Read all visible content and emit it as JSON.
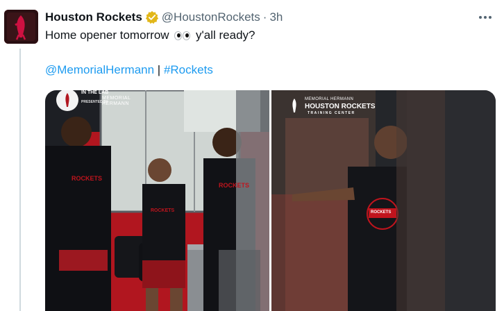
{
  "tweet": {
    "author_name": "Houston Rockets",
    "handle": "@HoustonRockets",
    "separator": "·",
    "time": "3h",
    "text_before": "Home opener tomorrow",
    "text_after": "y'all ready?",
    "emoji": "eyes",
    "mention": "@MemorialHermann",
    "tag_separator": " | ",
    "hashtag": "#Rockets"
  },
  "media": {
    "photo1": {
      "badge_title": "IN THE LAB",
      "badge_presented": "PRESENTED BY",
      "sponsor_line1": "MEMORIAL",
      "sponsor_line2": "HERMANN",
      "jersey_left": "ROCKETS",
      "jersey_center": "ROCKETS",
      "jersey_right": "ROCKETS"
    },
    "photo2": {
      "logo_line1": "MEMORIAL HERMANN",
      "logo_line2": "HOUSTON ROCKETS",
      "logo_line3": "TRAINING CENTER",
      "shirt_text": "ROCKETS"
    }
  },
  "colors": {
    "link": "#1d9bf0",
    "brand_red": "#ce1141",
    "verified_gold": "#e2b719"
  }
}
